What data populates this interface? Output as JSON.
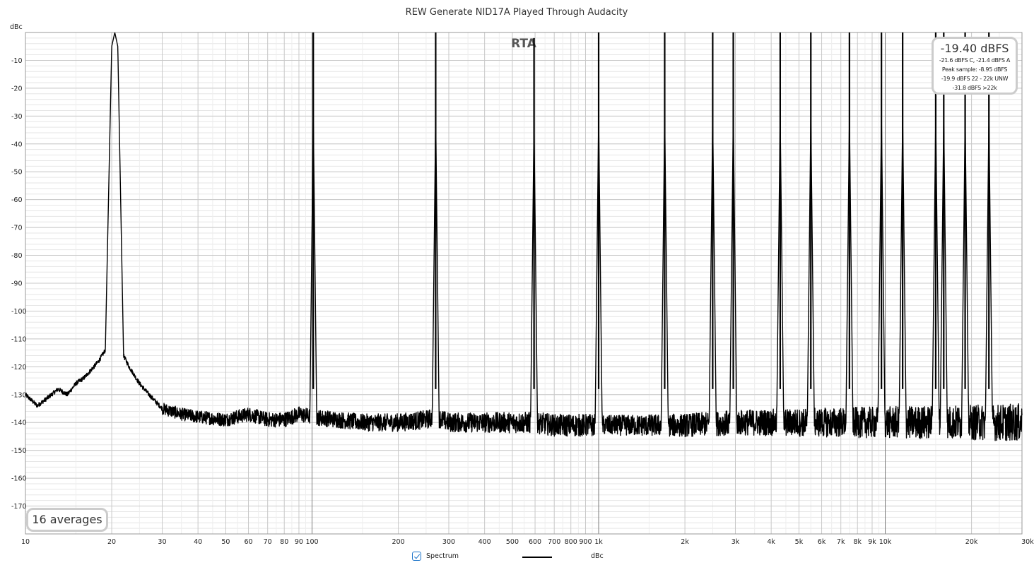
{
  "chart_data": {
    "type": "line",
    "title": "REW Generate NID17A Played Through Audacity",
    "ylabel": "dBc",
    "overlay_label": "RTA",
    "xscale": "log",
    "xlim": [
      10,
      30000
    ],
    "ylim": [
      -180,
      0
    ],
    "grid": true,
    "legend_position": "bottom-center",
    "x_ticks": [
      {
        "value": 10,
        "label": "10"
      },
      {
        "value": 20,
        "label": "20"
      },
      {
        "value": 30,
        "label": "30"
      },
      {
        "value": 40,
        "label": "40"
      },
      {
        "value": 50,
        "label": "50"
      },
      {
        "value": 60,
        "label": "60"
      },
      {
        "value": 70,
        "label": "70"
      },
      {
        "value": 80,
        "label": "80"
      },
      {
        "value": 90,
        "label": "90"
      },
      {
        "value": 100,
        "label": "100"
      },
      {
        "value": 200,
        "label": "200"
      },
      {
        "value": 300,
        "label": "300"
      },
      {
        "value": 400,
        "label": "400"
      },
      {
        "value": 500,
        "label": "500"
      },
      {
        "value": 600,
        "label": "600"
      },
      {
        "value": 700,
        "label": "700"
      },
      {
        "value": 800,
        "label": "800"
      },
      {
        "value": 900,
        "label": "900"
      },
      {
        "value": 1000,
        "label": "1k"
      },
      {
        "value": 2000,
        "label": "2k"
      },
      {
        "value": 3000,
        "label": "3k"
      },
      {
        "value": 4000,
        "label": "4k"
      },
      {
        "value": 5000,
        "label": "5k"
      },
      {
        "value": 6000,
        "label": "6k"
      },
      {
        "value": 7000,
        "label": "7k"
      },
      {
        "value": 8000,
        "label": "8k"
      },
      {
        "value": 9000,
        "label": "9k"
      },
      {
        "value": 10000,
        "label": "10k"
      },
      {
        "value": 20000,
        "label": "20k"
      },
      {
        "value": 30000,
        "label": "30kHz"
      }
    ],
    "y_ticks": [
      {
        "value": -10,
        "label": "-10"
      },
      {
        "value": -20,
        "label": "-20"
      },
      {
        "value": -30,
        "label": "-30"
      },
      {
        "value": -40,
        "label": "-40"
      },
      {
        "value": -50,
        "label": "-50"
      },
      {
        "value": -60,
        "label": "-60"
      },
      {
        "value": -70,
        "label": "-70"
      },
      {
        "value": -80,
        "label": "-80"
      },
      {
        "value": -90,
        "label": "-90"
      },
      {
        "value": -100,
        "label": "-100"
      },
      {
        "value": -110,
        "label": "-110"
      },
      {
        "value": -120,
        "label": "-120"
      },
      {
        "value": -130,
        "label": "-130"
      },
      {
        "value": -140,
        "label": "-140"
      },
      {
        "value": -150,
        "label": "-150"
      },
      {
        "value": -160,
        "label": "-160"
      },
      {
        "value": -170,
        "label": "-170"
      }
    ],
    "series": [
      {
        "name": "Spectrum",
        "color": "#000000",
        "noise_floor_db": -140,
        "x": [
          10,
          11,
          12,
          13,
          14,
          15,
          16,
          17,
          18,
          19,
          20,
          20.5,
          21,
          22,
          23,
          25,
          27,
          30,
          35,
          40,
          50,
          60,
          70,
          80,
          90,
          100,
          150,
          200,
          250,
          270,
          300,
          400,
          500,
          600,
          700,
          800,
          1000,
          1500,
          2000,
          3000,
          5000,
          10000,
          20000,
          30000
        ],
        "y": [
          -130,
          -134,
          -131,
          -128,
          -130,
          -126,
          -124,
          -121,
          -118,
          -114,
          -5,
          0,
          -5,
          -116,
          -120,
          -126,
          -130,
          -135,
          -137,
          -138,
          -139,
          -137,
          -139,
          -139,
          -137,
          -138,
          -140,
          -140,
          -139,
          -138,
          -140,
          -140,
          -140,
          -140,
          -141,
          -141,
          -141,
          -141,
          -141,
          -140,
          -140,
          -140,
          -140,
          -140
        ]
      }
    ],
    "peaks": [
      {
        "freq": 20.5,
        "level": 0
      },
      {
        "freq": 101,
        "level": 0
      },
      {
        "freq": 270,
        "level": 0
      },
      {
        "freq": 595,
        "level": -2
      },
      {
        "freq": 1000,
        "level": 0
      },
      {
        "freq": 1700,
        "level": 0
      },
      {
        "freq": 2500,
        "level": 0
      },
      {
        "freq": 2950,
        "level": 0
      },
      {
        "freq": 4300,
        "level": 0
      },
      {
        "freq": 5500,
        "level": 0
      },
      {
        "freq": 7500,
        "level": 0
      },
      {
        "freq": 9700,
        "level": 0
      },
      {
        "freq": 11500,
        "level": 0
      },
      {
        "freq": 15000,
        "level": 0
      },
      {
        "freq": 16000,
        "level": 0
      },
      {
        "freq": 19000,
        "level": 0
      },
      {
        "freq": 23000,
        "level": 0
      }
    ]
  },
  "meter": {
    "main": "-19.40 dBFS",
    "line1": "-21.6 dBFS C, -21.4 dBFS A",
    "line2": "Peak sample: -8.95 dBFS",
    "line3": "-19.9 dBFS 22 - 22k UNW",
    "line4": "-31.8 dBFS >22k"
  },
  "averages": "16 averages",
  "legend": {
    "checkbox_label": "Spectrum",
    "checked": true,
    "unit_label": "dBc"
  }
}
